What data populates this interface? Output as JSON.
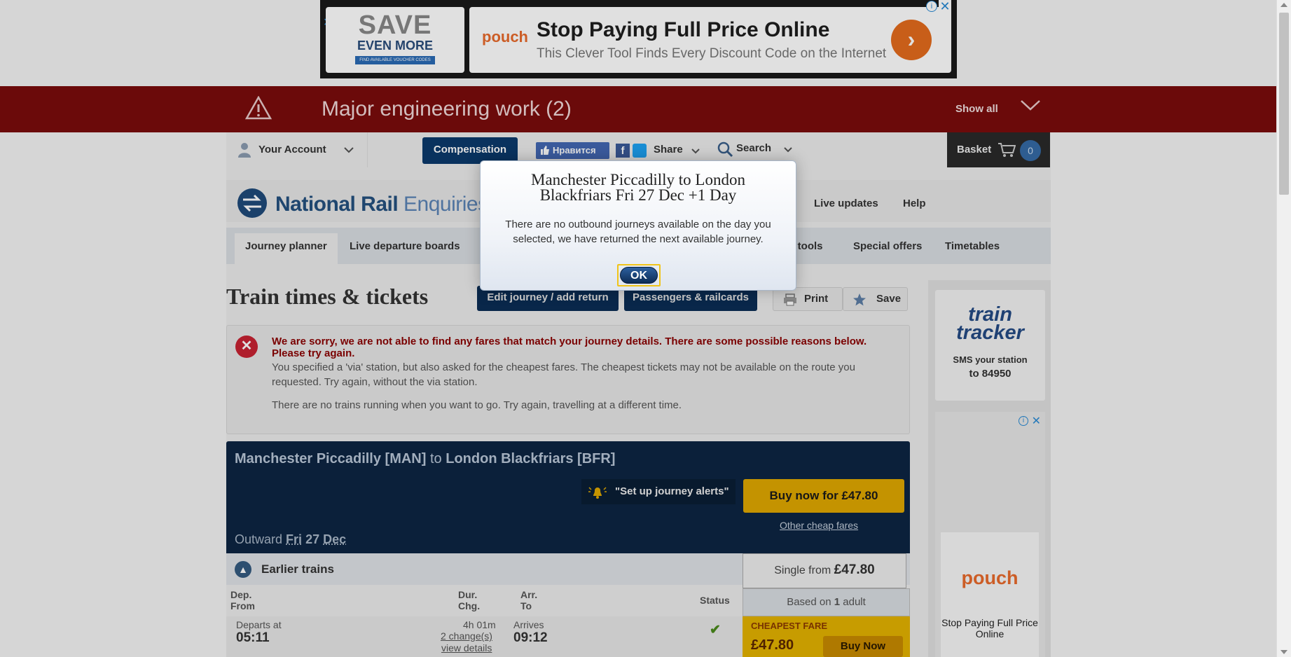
{
  "ad_top": {
    "save_line1": "SAVE",
    "save_line2": "EVEN MORE",
    "save_badge": "FIND AVAILABLE VOUCHER CODES",
    "brand": "pouch",
    "headline": "Stop Paying Full Price Online",
    "subline": "This Clever Tool Finds Every Discount Code on the Internet",
    "arrow": "›",
    "info": "i",
    "close": "✕"
  },
  "engineering": {
    "title": "Major engineering work (2)",
    "show_all": "Show all"
  },
  "header": {
    "account": "Your Account",
    "compensation": "Compensation",
    "like": "Нравится",
    "share": "Share",
    "search": "Search",
    "basket": "Basket",
    "basket_count": "0"
  },
  "logo": {
    "bold": "National Rail",
    "light": "Enquiries"
  },
  "top_links": [
    "Live updates",
    "Help"
  ],
  "tabs": [
    "Journey planner",
    "Live departure boards",
    "el tools",
    "Special offers",
    "Timetables"
  ],
  "page": {
    "title": "Train times & tickets",
    "edit_journey": "Edit journey / add return",
    "passengers": "Passengers & railcards",
    "print": "Print",
    "save": "Save"
  },
  "error": {
    "head": "We are sorry, we are not able to find any fares that match your journey details. There are some possible reasons below. Please try again.",
    "p1": "You specified a 'via' station, but also asked for the cheapest fares. The cheapest tickets may not be available on the route you requested. Try again, without the via station.",
    "p2": "There are no trains running when you want to go. Try again, travelling at a different time."
  },
  "journey": {
    "from": "Manchester Piccadilly [MAN]",
    "to_word": "to",
    "to": "London Blackfriars [BFR]",
    "alert": "\"Set up journey alerts\"",
    "buy_now": "Buy now for £47.80",
    "other_fares": "Other cheap fares",
    "outward_label": "Outward",
    "outward_day": "Fri",
    "outward_date": "27",
    "outward_month": "Dec",
    "earlier": "Earlier trains",
    "single_from": "Single from",
    "single_price": "£47.80",
    "based_on": "Based on",
    "based_count": "1",
    "based_unit": "adult"
  },
  "columns": {
    "dep": "Dep.",
    "from": "From",
    "dur": "Dur.",
    "chg": "Chg.",
    "arr": "Arr.",
    "to": "To",
    "status": "Status"
  },
  "row": {
    "departs_label": "Departs at",
    "departs": "05:11",
    "duration": "4h 01m",
    "changes": "2 change(s)",
    "view_details": "view details",
    "arrives_label": "Arrives",
    "arrives": "09:12",
    "status_icon": "✔"
  },
  "cheapest": {
    "label": "CHEAPEST FARE",
    "price": "£47.80",
    "buy": "Buy Now"
  },
  "sidebar": {
    "tt_line1": "train",
    "tt_line2": "tracker",
    "tt_sms": "SMS your station",
    "tt_num": "to 84950",
    "ad_brand": "pouch",
    "ad_text": "Stop Paying Full Price Online"
  },
  "dialog": {
    "title": "Manchester Piccadilly to London Blackfriars Fri 27 Dec +1 Day",
    "body": "There are no outbound journeys available on the day you selected, we have returned the next available journey.",
    "ok": "OK"
  },
  "colors": {
    "banner": "#7a0c0c",
    "navy": "#0b2d55",
    "gold": "#e0a800"
  }
}
